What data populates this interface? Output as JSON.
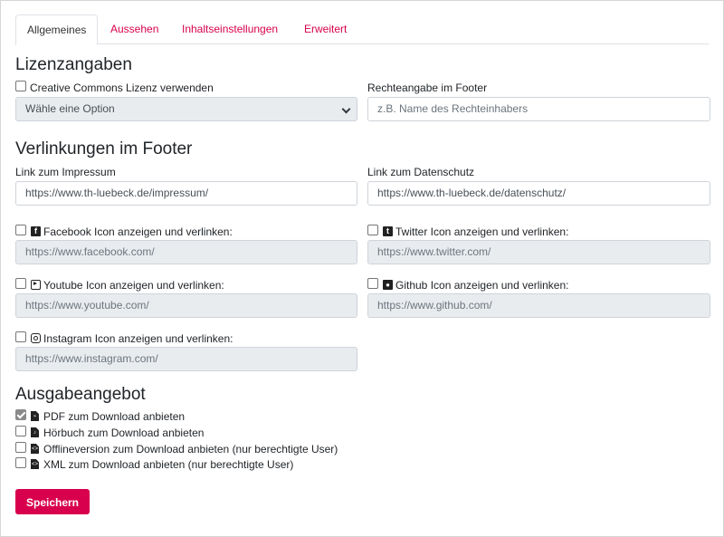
{
  "tabs": [
    "Allgemeines",
    "Aussehen",
    "Inhaltseinstellungen",
    "Erweitert"
  ],
  "license": {
    "heading": "Lizenzangaben",
    "cc_label": "Creative Commons Lizenz verwenden",
    "cc_checked": false,
    "select_value": "Wähle eine Option",
    "rights_label": "Rechteangabe im Footer",
    "rights_placeholder": "z.B. Name des Rechteinhabers"
  },
  "links": {
    "heading": "Verlinkungen im Footer",
    "imprint_label": "Link zum Impressum",
    "imprint_value": "https://www.th-luebeck.de/impressum/",
    "privacy_label": "Link zum Datenschutz",
    "privacy_value": "https://www.th-luebeck.de/datenschutz/",
    "facebook_label": "Facebook Icon anzeigen und verlinken:",
    "facebook_value": "https://www.facebook.com/",
    "twitter_label": "Twitter Icon anzeigen und verlinken:",
    "twitter_value": "https://www.twitter.com/",
    "youtube_label": "Youtube Icon anzeigen und verlinken:",
    "youtube_value": "https://www.youtube.com/",
    "github_label": "Github Icon anzeigen und verlinken:",
    "github_value": "https://www.github.com/",
    "instagram_label": "Instagram Icon anzeigen und verlinken:",
    "instagram_value": "https://www.instagram.com/"
  },
  "output": {
    "heading": "Ausgabeangebot",
    "pdf_label": "PDF zum Download anbieten",
    "pdf_checked": true,
    "audiobook_label": "Hörbuch zum Download anbieten",
    "offline_label": "Offlineversion zum Download anbieten (nur berechtigte User)",
    "xml_label": "XML zum Download anbieten (nur berechtigte User)"
  },
  "save_label": "Speichern",
  "colors": {
    "accent": "#d8004c",
    "disabled_bg": "#e9ecef"
  },
  "icons": [
    "facebook-icon",
    "twitter-icon",
    "youtube-icon",
    "github-icon",
    "instagram-icon",
    "pdf-file-icon",
    "audio-file-icon",
    "code-file-icon",
    "code-file-icon"
  ]
}
